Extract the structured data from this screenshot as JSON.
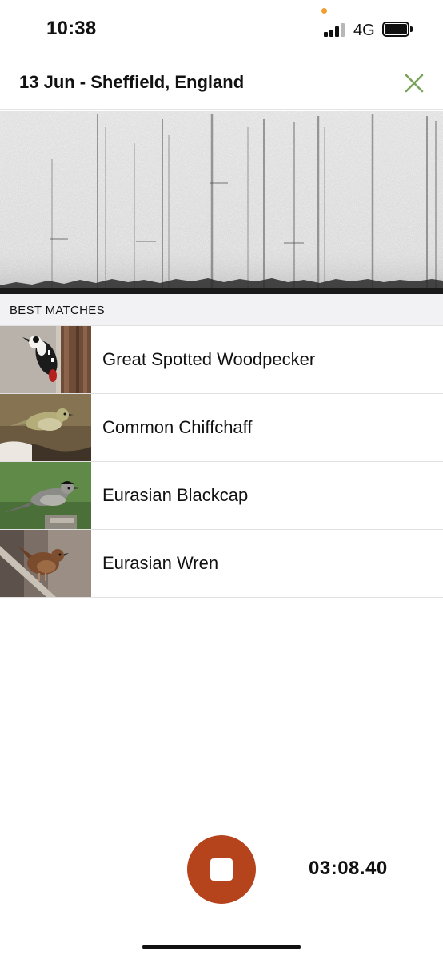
{
  "status_bar": {
    "time": "10:38",
    "network": "4G",
    "icons": [
      "signal-icon",
      "battery-icon"
    ]
  },
  "header": {
    "title": "13 Jun - Sheffield, England",
    "close_icon": "close-x-icon",
    "accent_color": "#7aa35a"
  },
  "section": {
    "label": "BEST MATCHES"
  },
  "matches": [
    {
      "name": "Great Spotted Woodpecker"
    },
    {
      "name": "Common Chiffchaff"
    },
    {
      "name": "Eurasian Blackcap"
    },
    {
      "name": "Eurasian Wren"
    }
  ],
  "controls": {
    "stop_icon": "stop-icon",
    "stop_color": "#b5431c",
    "timer": "03:08.40"
  }
}
